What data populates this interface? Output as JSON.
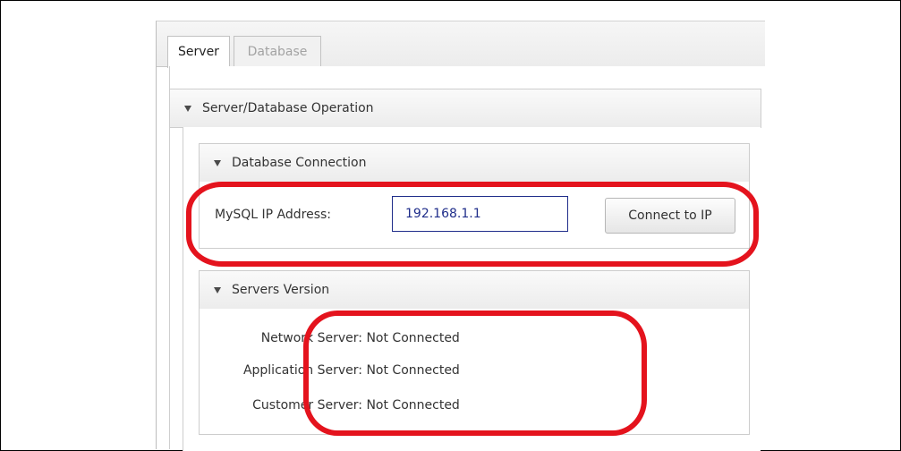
{
  "tabs": [
    {
      "label": "Server",
      "active": true
    },
    {
      "label": "Database",
      "active": false
    }
  ],
  "panels": {
    "operation": {
      "title": "Server/Database Operation"
    },
    "db_connection": {
      "title": "Database Connection",
      "ip_label": "MySQL IP Address:",
      "ip_value": "192.168.1.1",
      "connect_label": "Connect to IP"
    },
    "servers_version": {
      "title": "Servers Version",
      "rows": [
        {
          "label": "Network Server:",
          "value": "Not Connected"
        },
        {
          "label": "Application Server:",
          "value": "Not Connected"
        },
        {
          "label": "Customer Server:",
          "value": "Not Connected"
        }
      ]
    }
  },
  "colors": {
    "annotation": "#e4131d",
    "input_border": "#1f2d8a",
    "input_text": "#1f2d8a",
    "disabled_tab_text": "#a3a3a3"
  },
  "icons": [
    "expand-triangle-icon"
  ]
}
